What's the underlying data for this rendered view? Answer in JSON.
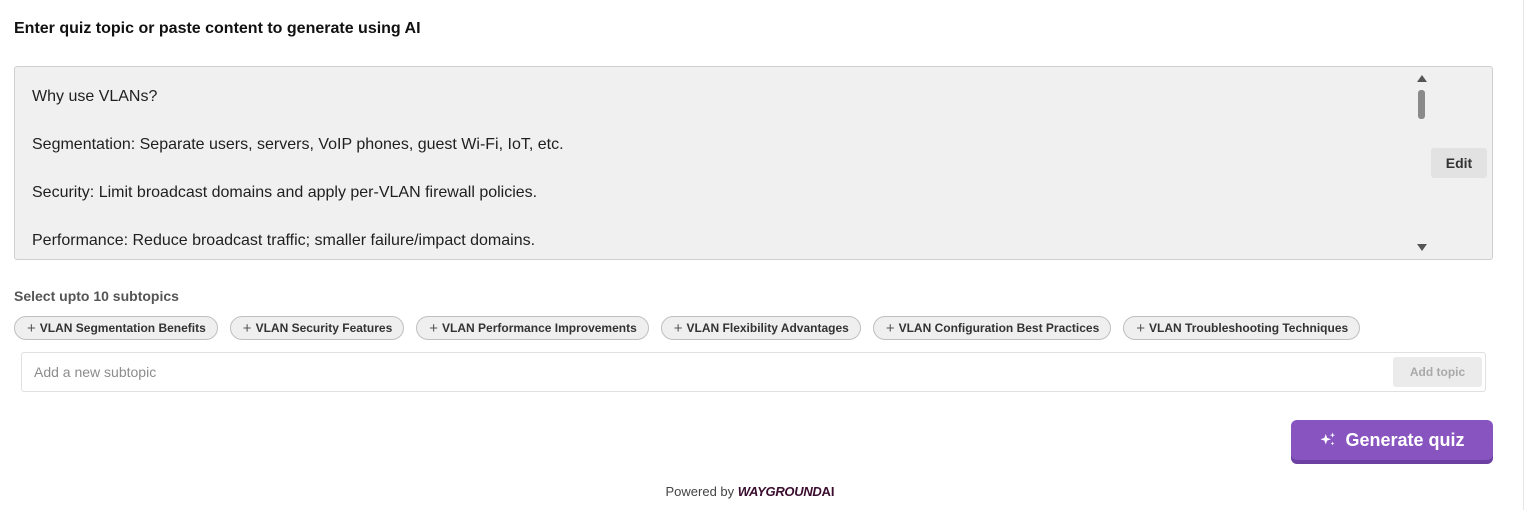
{
  "heading": "Enter quiz topic or paste content to generate using AI",
  "content": {
    "lines": [
      "Why use VLANs?",
      "Segmentation: Separate users, servers, VoIP phones, guest Wi-Fi, IoT, etc.",
      "Security: Limit broadcast domains and apply per-VLAN firewall policies.",
      "Performance: Reduce broadcast traffic; smaller failure/impact domains."
    ],
    "edit_label": "Edit"
  },
  "subtopics": {
    "label": "Select upto 10 subtopics",
    "chips": [
      "VLAN Segmentation Benefits",
      "VLAN Security Features",
      "VLAN Performance Improvements",
      "VLAN Flexibility Advantages",
      "VLAN Configuration Best Practices",
      "VLAN Troubleshooting Techniques"
    ],
    "input_placeholder": "Add a new subtopic",
    "add_label": "Add topic"
  },
  "generate_label": "Generate quiz",
  "footer": {
    "powered_by": "Powered by",
    "brand": "WAYGROUND",
    "brand_suffix": "AI"
  },
  "colors": {
    "accent": "#8854c0",
    "brand": "#3a0d2e"
  }
}
